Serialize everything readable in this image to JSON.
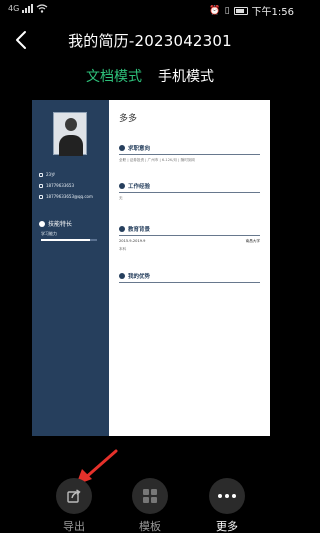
{
  "status_bar": {
    "signal_label": "4G",
    "time": "下午1:56"
  },
  "header": {
    "title": "我的简历-2023042301",
    "back_icon": "chevron-left-icon"
  },
  "tabs": [
    {
      "label": "文档模式",
      "active": true
    },
    {
      "label": "手机模式",
      "active": false
    }
  ],
  "resume": {
    "name": "多多",
    "side": {
      "info": [
        "23岁",
        "18779633653",
        "18779633653@qq.com"
      ],
      "skill_header": "技能特长",
      "skill_item": "学习能力",
      "skill_level": 0.88
    },
    "sections": [
      {
        "title": "求职意向",
        "row_left": "全职 | 证券投资 | 广州市 | 6-12K/月 | 随时到岗",
        "row_right": ""
      },
      {
        "title": "工作经验",
        "row_left": "无",
        "row_right": ""
      },
      {
        "title": "教育背景",
        "row_left": "2015.9-2019.9",
        "row_right": "南昌大学",
        "row2": "本科"
      },
      {
        "title": "我的优势",
        "row_left": "",
        "row_right": ""
      }
    ]
  },
  "bottom_bar": {
    "export_label": "导出",
    "template_label": "模板",
    "more_label": "更多"
  },
  "colors": {
    "accent": "#2ec07a",
    "resume_sidebar": "#263f5d",
    "pointer_arrow": "#e5312b"
  }
}
